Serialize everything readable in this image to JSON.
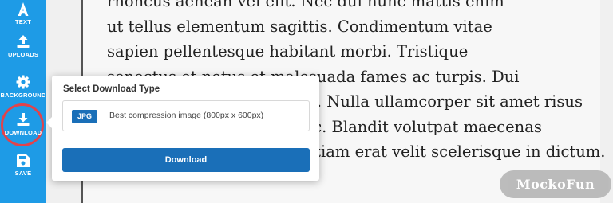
{
  "sidebar": {
    "accent_color": "#1e9be6",
    "items": [
      {
        "label": "TEXT",
        "icon": "text-icon"
      },
      {
        "label": "UPLOADS",
        "icon": "upload-icon"
      },
      {
        "label": "BACKGROUND",
        "icon": "gear-icon"
      },
      {
        "label": "DOWNLOAD",
        "icon": "download-icon"
      },
      {
        "label": "SAVE",
        "icon": "floppy-disk-icon"
      }
    ],
    "highlight_color": "#e2434b"
  },
  "document": {
    "lines": [
      "rhoncus aenean vel elit. Nec dui nunc mattis enim",
      "ut tellus elementum sagittis. Condimentum vitae",
      "sapien pellentesque habitant morbi. Tristique",
      "senectus et netus et malesuada fames ac turpis. Dui",
      "id ornare arcu odio ut sem. Nulla ullamcorper sit amet risus",
      "nullam eget felis eget nunc. Blandit volutpat maecenas",
      "volutpat blandit aliquam etiam erat velit scelerisque in dictum."
    ]
  },
  "download_popup": {
    "title": "Select Download Type",
    "option": {
      "format": "JPG",
      "description": "Best compression image (800px x 600px)"
    },
    "button_label": "Download",
    "button_color": "#1a6fb8"
  },
  "watermark": "MockoFun"
}
